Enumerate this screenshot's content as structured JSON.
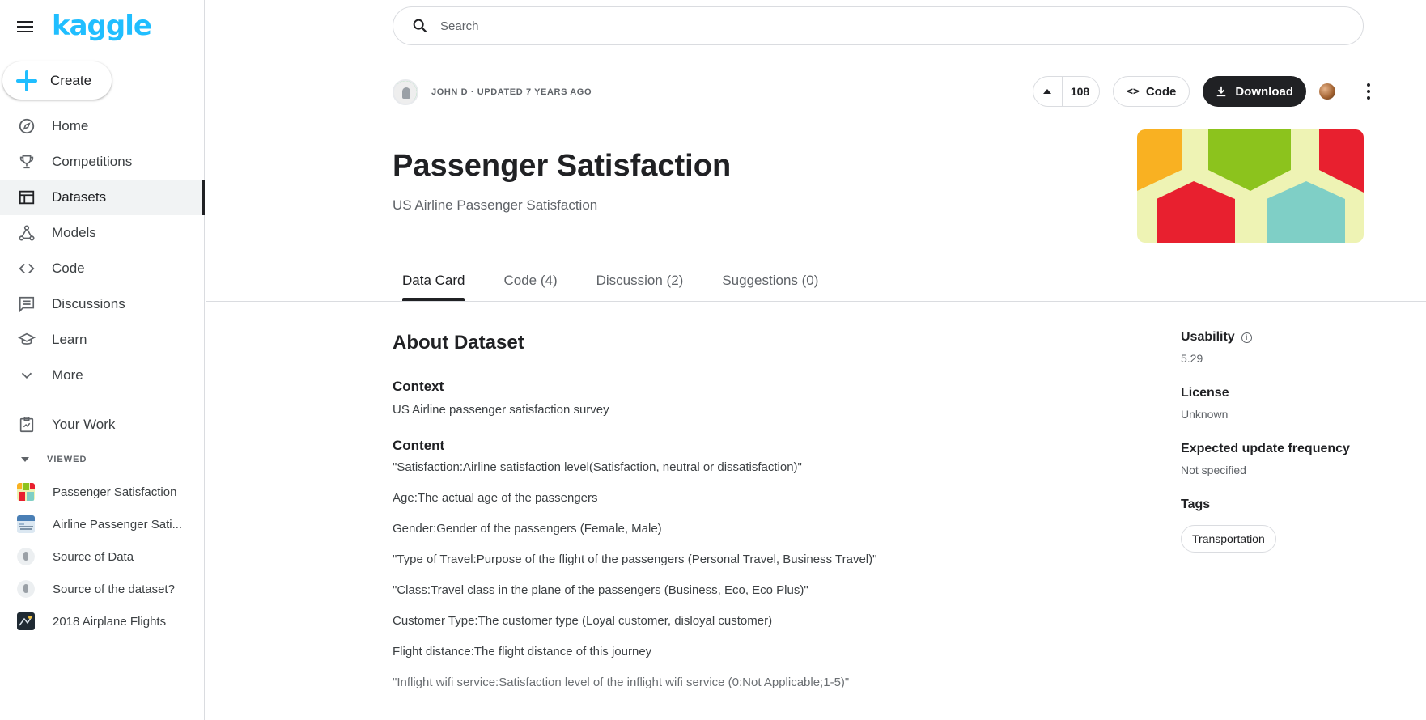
{
  "brand": {
    "logo": "kaggle"
  },
  "sidebar": {
    "create_label": "Create",
    "items": [
      {
        "label": "Home",
        "icon": "compass-icon"
      },
      {
        "label": "Competitions",
        "icon": "trophy-icon"
      },
      {
        "label": "Datasets",
        "icon": "table-icon",
        "active": true
      },
      {
        "label": "Models",
        "icon": "models-icon"
      },
      {
        "label": "Code",
        "icon": "code-icon"
      },
      {
        "label": "Discussions",
        "icon": "discussion-icon"
      },
      {
        "label": "Learn",
        "icon": "school-icon"
      },
      {
        "label": "More",
        "icon": "chevron-down-icon"
      }
    ],
    "your_work": "Your Work",
    "viewed_header": "VIEWED",
    "viewed": [
      {
        "label": "Passenger Satisfaction"
      },
      {
        "label": "Airline Passenger Sati..."
      },
      {
        "label": "Source of Data"
      },
      {
        "label": "Source of the dataset?"
      },
      {
        "label": "2018 Airplane Flights"
      }
    ]
  },
  "search": {
    "placeholder": "Search"
  },
  "dataset": {
    "meta": "JOHN D · UPDATED 7 YEARS AGO",
    "votes": "108",
    "code_label": "Code",
    "download_label": "Download",
    "title": "Passenger Satisfaction",
    "subtitle": "US Airline Passenger Satisfaction"
  },
  "tabs": [
    "Data Card",
    "Code (4)",
    "Discussion (2)",
    "Suggestions (0)"
  ],
  "about": {
    "heading": "About Dataset",
    "context_heading": "Context",
    "context_text": "US Airline passenger satisfaction survey",
    "content_heading": "Content",
    "lines": [
      "\"Satisfaction:Airline satisfaction level(Satisfaction, neutral or dissatisfaction)\"",
      "Age:The actual age of the passengers",
      "Gender:Gender of the passengers (Female, Male)",
      "\"Type of Travel:Purpose of the flight of the passengers (Personal Travel, Business Travel)\"",
      "\"Class:Travel class in the plane of the passengers (Business, Eco, Eco Plus)\"",
      "Customer Type:The customer type (Loyal customer, disloyal customer)",
      "Flight distance:The flight distance of this journey",
      "\"Inflight wifi service:Satisfaction level of the inflight wifi service (0:Not Applicable;1-5)\""
    ]
  },
  "side": {
    "usability_label": "Usability",
    "usability_value": "5.29",
    "license_label": "License",
    "license_value": "Unknown",
    "frequency_label": "Expected update frequency",
    "frequency_value": "Not specified",
    "tags_label": "Tags",
    "tags": [
      "Transportation"
    ]
  },
  "colors": {
    "brand": "#20beff",
    "dark": "#202124",
    "banner_bg": "#eef3b4"
  }
}
